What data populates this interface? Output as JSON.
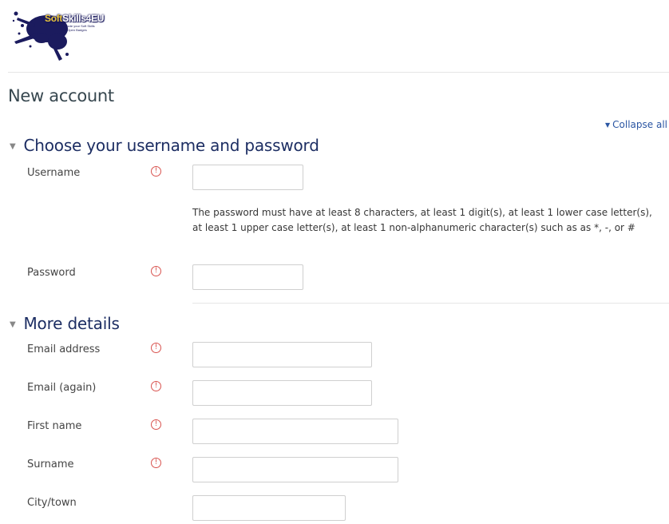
{
  "logo": {
    "brand_a": "Soft",
    "brand_b": "Skills4EU",
    "tagline": "Promote your Soft Skills with Open Badges"
  },
  "page": {
    "title": "New account",
    "collapse_all": "Collapse all"
  },
  "sections": {
    "account": {
      "title": "Choose your username and password"
    },
    "details": {
      "title": "More details"
    }
  },
  "fields": {
    "username": {
      "label": "Username",
      "value": ""
    },
    "password_hint": "The password must have at least 8 characters, at least 1 digit(s), at least 1 lower case letter(s), at least 1 upper case letter(s), at least 1 non-alphanumeric character(s) such as as *, -, or #",
    "password": {
      "label": "Password",
      "value": ""
    },
    "email": {
      "label": "Email address",
      "value": ""
    },
    "email2": {
      "label": "Email (again)",
      "value": ""
    },
    "firstname": {
      "label": "First name",
      "value": ""
    },
    "surname": {
      "label": "Surname",
      "value": ""
    },
    "city": {
      "label": "City/town",
      "value": ""
    }
  },
  "icons": {
    "required": "exclamation-circle-icon",
    "expand": "triangle-down-icon"
  },
  "colors": {
    "required": "#d9534f",
    "section_heading": "#1d2e63",
    "link": "#2b56a3",
    "brand_accent": "#e9c53a"
  }
}
